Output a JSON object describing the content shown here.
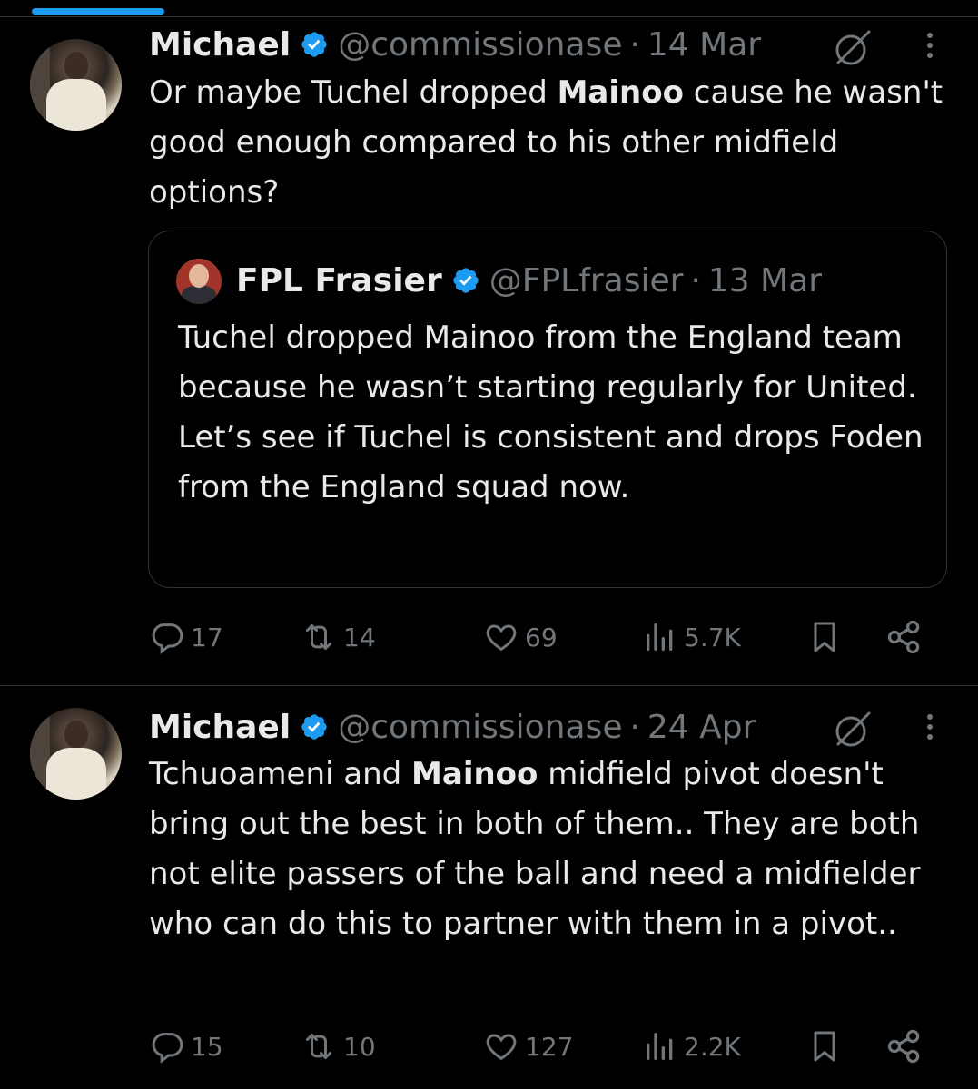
{
  "colors": {
    "background": "#000000",
    "text": "#e7e9ea",
    "muted": "#71767b",
    "accent": "#1d9bf0",
    "border": "#2f3336"
  },
  "tweets": [
    {
      "author": {
        "name": "Michael",
        "handle": "@commissionase",
        "verified": true
      },
      "separator": "·",
      "date": "14 Mar",
      "text_parts": [
        "Or maybe Tuchel dropped ",
        "Mainoo",
        " cause he wasn't good enough compared to his other midfield options?"
      ],
      "quote": {
        "author": {
          "name": "FPL Frasier",
          "handle": "@FPLfrasier",
          "verified": true
        },
        "separator": "·",
        "date": "13 Mar",
        "text": "Tuchel dropped Mainoo from the England team because he wasn’t starting regularly for United. Let’s see if Tuchel is consistent and drops Foden from the England squad now."
      },
      "stats": {
        "replies": "17",
        "reposts": "14",
        "likes": "69",
        "views": "5.7K"
      }
    },
    {
      "author": {
        "name": "Michael",
        "handle": "@commissionase",
        "verified": true
      },
      "separator": "·",
      "date": "24 Apr",
      "text_parts": [
        "Tchuoameni and ",
        "Mainoo",
        " midfield pivot doesn't bring out the best in both of them.. They are both not elite passers of the ball and need a midfielder who can do this to partner with them in a pivot.."
      ],
      "stats": {
        "replies": "15",
        "reposts": "10",
        "likes": "127",
        "views": "2.2K"
      }
    }
  ],
  "icons": {
    "verified": "verified-badge-icon",
    "grok": "grok-icon",
    "more": "more-vertical-icon",
    "reply": "reply-icon",
    "repost": "repost-icon",
    "like": "heart-icon",
    "views": "views-icon",
    "bookmark": "bookmark-icon",
    "share": "share-icon"
  }
}
